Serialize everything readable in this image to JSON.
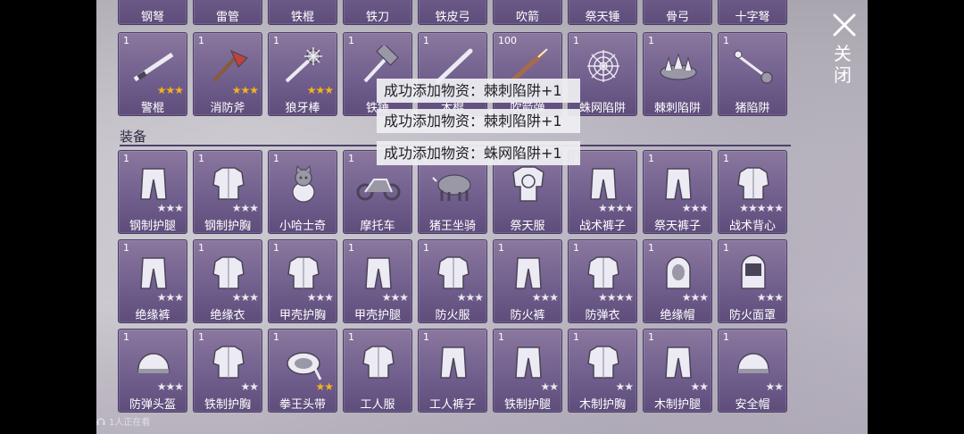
{
  "top_row_partial_labels": [
    "钢弩",
    "雷管",
    "铁棍",
    "铁刀",
    "铁皮弓",
    "吹箭",
    "祭天锤",
    "骨弓",
    "十字弩"
  ],
  "weapons_row": [
    {
      "count": "1",
      "label": "警棍",
      "stars": 3,
      "star_color": "gold",
      "icon": "baton-icon"
    },
    {
      "count": "1",
      "label": "消防斧",
      "stars": 3,
      "star_color": "gold",
      "icon": "fire-axe-icon"
    },
    {
      "count": "1",
      "label": "狼牙棒",
      "stars": 3,
      "star_color": "gold",
      "icon": "spiked-mace-icon"
    },
    {
      "count": "1",
      "label": "铁锤",
      "stars": 0,
      "star_color": "white",
      "icon": "hammer-icon"
    },
    {
      "count": "1",
      "label": "木棍",
      "stars": 0,
      "star_color": "white",
      "icon": "wooden-stick-icon"
    },
    {
      "count": "100",
      "label": "吹箭弹",
      "stars": 0,
      "star_color": "white",
      "icon": "dart-icon"
    },
    {
      "count": "1",
      "label": "蛛网陷阱",
      "stars": 0,
      "star_color": "white",
      "icon": "spiderweb-trap-icon"
    },
    {
      "count": "1",
      "label": "棘刺陷阱",
      "stars": 0,
      "star_color": "white",
      "icon": "thorn-trap-icon"
    },
    {
      "count": "1",
      "label": "猪陷阱",
      "stars": 0,
      "star_color": "white",
      "icon": "pig-trap-icon"
    }
  ],
  "section": {
    "title": "装备"
  },
  "equipment_rows": [
    [
      {
        "count": "1",
        "label": "钢制护腿",
        "stars": 3,
        "star_color": "white",
        "icon": "steel-leg-guard-icon"
      },
      {
        "count": "1",
        "label": "钢制护胸",
        "stars": 3,
        "star_color": "white",
        "icon": "steel-chest-guard-icon"
      },
      {
        "count": "1",
        "label": "小哈士奇",
        "stars": 0,
        "star_color": "white",
        "icon": "husky-pet-icon"
      },
      {
        "count": "1",
        "label": "摩托车",
        "stars": 0,
        "star_color": "white",
        "icon": "motorcycle-icon"
      },
      {
        "count": "1",
        "label": "猪王坐骑",
        "stars": 0,
        "star_color": "white",
        "icon": "boar-mount-icon"
      },
      {
        "count": "1",
        "label": "祭天服",
        "stars": 0,
        "star_color": "white",
        "icon": "ritual-robe-icon"
      },
      {
        "count": "1",
        "label": "战术裤子",
        "stars": 4,
        "star_color": "white",
        "icon": "tactical-pants-icon"
      },
      {
        "count": "1",
        "label": "祭天裤子",
        "stars": 3,
        "star_color": "white",
        "icon": "ritual-pants-icon"
      },
      {
        "count": "1",
        "label": "战术背心",
        "stars": 5,
        "star_color": "white",
        "icon": "tactical-vest-icon"
      }
    ],
    [
      {
        "count": "1",
        "label": "绝缘裤",
        "stars": 3,
        "star_color": "white",
        "icon": "insulated-pants-icon"
      },
      {
        "count": "1",
        "label": "绝缘衣",
        "stars": 3,
        "star_color": "white",
        "icon": "insulated-jacket-icon"
      },
      {
        "count": "1",
        "label": "甲壳护胸",
        "stars": 3,
        "star_color": "white",
        "icon": "shell-chest-guard-icon"
      },
      {
        "count": "1",
        "label": "甲壳护腿",
        "stars": 3,
        "star_color": "white",
        "icon": "shell-leg-guard-icon"
      },
      {
        "count": "1",
        "label": "防火服",
        "stars": 3,
        "star_color": "white",
        "icon": "fire-suit-icon"
      },
      {
        "count": "1",
        "label": "防火裤",
        "stars": 3,
        "star_color": "white",
        "icon": "fire-pants-icon"
      },
      {
        "count": "1",
        "label": "防弹衣",
        "stars": 4,
        "star_color": "white",
        "icon": "bulletproof-vest-icon"
      },
      {
        "count": "1",
        "label": "绝缘帽",
        "stars": 3,
        "star_color": "white",
        "icon": "insulated-hood-icon"
      },
      {
        "count": "1",
        "label": "防火面罩",
        "stars": 3,
        "star_color": "white",
        "icon": "fire-mask-icon"
      }
    ],
    [
      {
        "count": "1",
        "label": "防弹头盔",
        "stars": 3,
        "star_color": "white",
        "icon": "ballistic-helmet-icon"
      },
      {
        "count": "1",
        "label": "铁制护胸",
        "stars": 2,
        "star_color": "white",
        "icon": "iron-chest-guard-icon"
      },
      {
        "count": "1",
        "label": "拳王头带",
        "stars": 2,
        "star_color": "gold",
        "icon": "boxer-headband-icon"
      },
      {
        "count": "1",
        "label": "工人服",
        "stars": 0,
        "star_color": "white",
        "icon": "worker-jacket-icon"
      },
      {
        "count": "1",
        "label": "工人裤子",
        "stars": 0,
        "star_color": "white",
        "icon": "worker-pants-icon"
      },
      {
        "count": "1",
        "label": "铁制护腿",
        "stars": 2,
        "star_color": "white",
        "icon": "iron-leg-guard-icon"
      },
      {
        "count": "1",
        "label": "木制护胸",
        "stars": 2,
        "star_color": "white",
        "icon": "wood-chest-guard-icon"
      },
      {
        "count": "1",
        "label": "木制护腿",
        "stars": 2,
        "star_color": "white",
        "icon": "wood-leg-guard-icon"
      },
      {
        "count": "1",
        "label": "安全帽",
        "stars": 2,
        "star_color": "white",
        "icon": "safety-helmet-icon"
      }
    ]
  ],
  "toasts": [
    "成功添加物资：棘刺陷阱+1",
    "成功添加物资：棘刺陷阱+1",
    "成功添加物资：蛛网陷阱+1"
  ],
  "close_label": "关闭",
  "footer_status": "1人正在看",
  "colors": {
    "slot_bg": "#6f5d8c",
    "slot_border": "#4a3d66",
    "star_gold": "#f4b31a",
    "star_white": "#e8e8ee",
    "toast_bg": "#eeeef2"
  }
}
